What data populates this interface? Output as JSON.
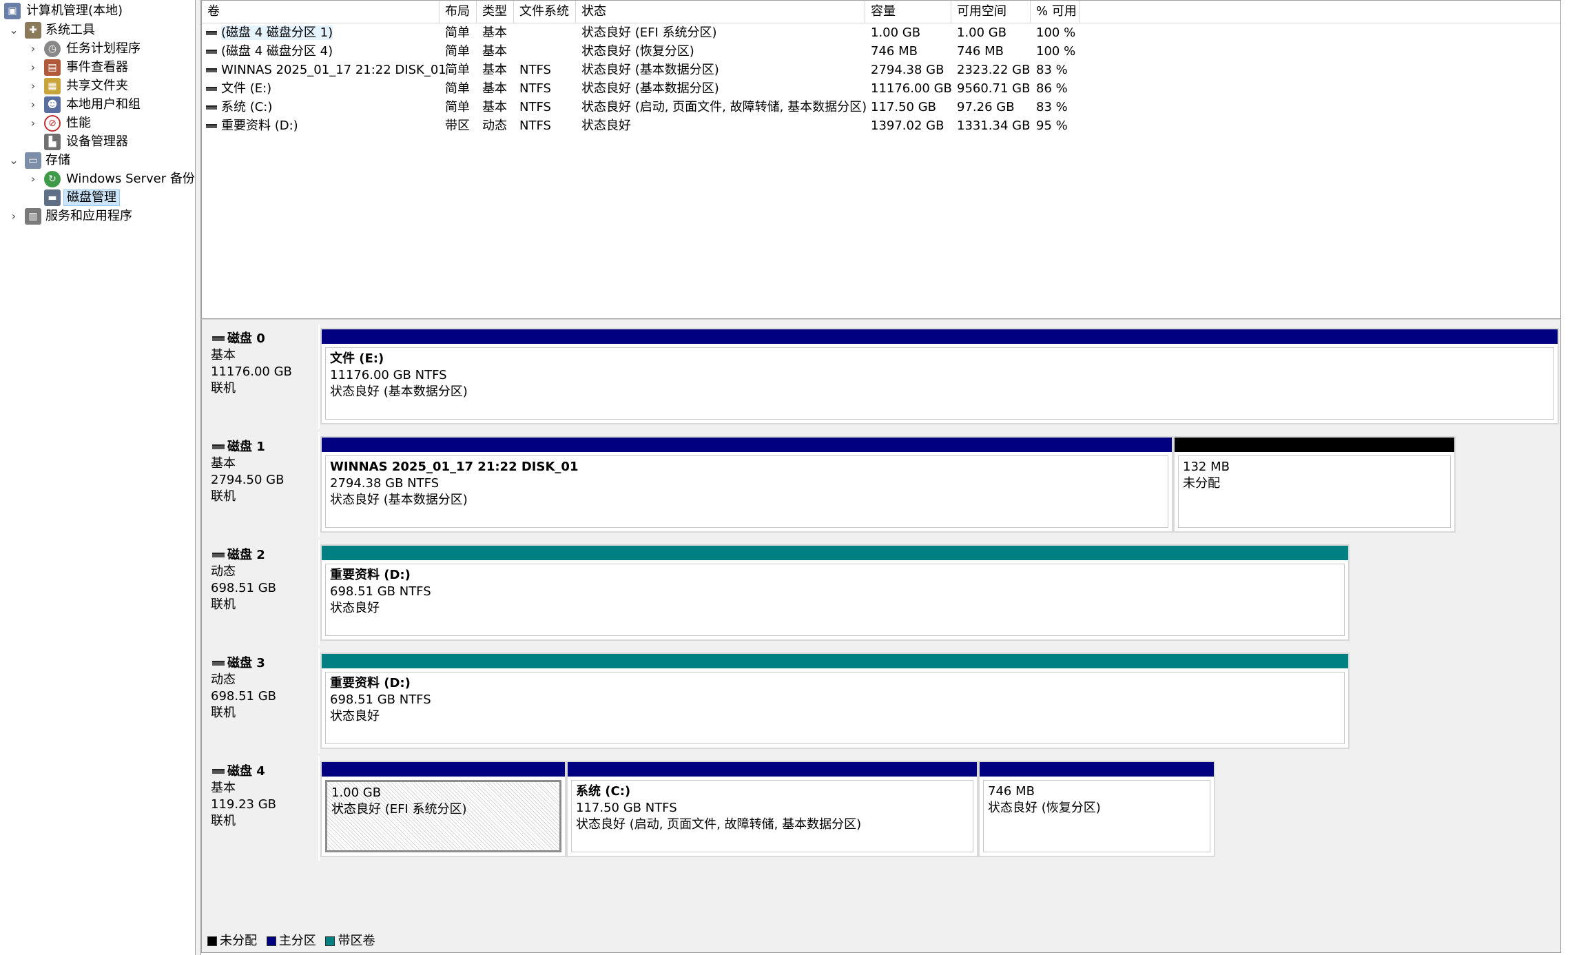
{
  "tree": {
    "root": "计算机管理(本地)",
    "system_tools": "系统工具",
    "task_scheduler": "任务计划程序",
    "event_viewer": "事件查看器",
    "shared_folders": "共享文件夹",
    "local_users": "本地用户和组",
    "performance": "性能",
    "device_manager": "设备管理器",
    "storage": "存储",
    "windows_server_backup": "Windows Server 备份",
    "disk_management": "磁盘管理",
    "services_apps": "服务和应用程序"
  },
  "columns": [
    "卷",
    "布局",
    "类型",
    "文件系统",
    "状态",
    "容量",
    "可用空间",
    "% 可用"
  ],
  "volumes": [
    {
      "name": "(磁盘 4 磁盘分区 1)",
      "layout": "简单",
      "type": "基本",
      "fs": "",
      "status": "状态良好 (EFI 系统分区)",
      "capacity": "1.00 GB",
      "free": "1.00 GB",
      "pct": "100 %"
    },
    {
      "name": "(磁盘 4 磁盘分区 4)",
      "layout": "简单",
      "type": "基本",
      "fs": "",
      "status": "状态良好 (恢复分区)",
      "capacity": "746 MB",
      "free": "746 MB",
      "pct": "100 %"
    },
    {
      "name": "WINNAS 2025_01_17 21:22 DISK_01",
      "layout": "简单",
      "type": "基本",
      "fs": "NTFS",
      "status": "状态良好 (基本数据分区)",
      "capacity": "2794.38 GB",
      "free": "2323.22 GB",
      "pct": "83 %"
    },
    {
      "name": "文件 (E:)",
      "layout": "简单",
      "type": "基本",
      "fs": "NTFS",
      "status": "状态良好 (基本数据分区)",
      "capacity": "11176.00 GB",
      "free": "9560.71 GB",
      "pct": "86 %"
    },
    {
      "name": "系统 (C:)",
      "layout": "简单",
      "type": "基本",
      "fs": "NTFS",
      "status": "状态良好 (启动, 页面文件, 故障转储, 基本数据分区)",
      "capacity": "117.50 GB",
      "free": "97.26 GB",
      "pct": "83 %"
    },
    {
      "name": "重要资料 (D:)",
      "layout": "带区",
      "type": "动态",
      "fs": "NTFS",
      "status": "状态良好",
      "capacity": "1397.02 GB",
      "free": "1331.34 GB",
      "pct": "95 %"
    }
  ],
  "disks": [
    {
      "name": "磁盘 0",
      "kind": "基本",
      "size": "11176.00 GB",
      "state": "联机",
      "partitions": [
        {
          "title": "文件  (E:)",
          "line1": "11176.00 GB NTFS",
          "line2": "状态良好 (基本数据分区)"
        }
      ]
    },
    {
      "name": "磁盘 1",
      "kind": "基本",
      "size": "2794.50 GB",
      "state": "联机",
      "partitions": [
        {
          "title": "WINNAS 2025_01_17 21:22 DISK_01",
          "line1": "2794.38 GB NTFS",
          "line2": "状态良好 (基本数据分区)"
        },
        {
          "title": "",
          "line1": "132 MB",
          "line2": "未分配"
        }
      ]
    },
    {
      "name": "磁盘 2",
      "kind": "动态",
      "size": "698.51 GB",
      "state": "联机",
      "partitions": [
        {
          "title": "重要资料  (D:)",
          "line1": "698.51 GB NTFS",
          "line2": "状态良好"
        }
      ]
    },
    {
      "name": "磁盘 3",
      "kind": "动态",
      "size": "698.51 GB",
      "state": "联机",
      "partitions": [
        {
          "title": "重要资料  (D:)",
          "line1": "698.51 GB NTFS",
          "line2": "状态良好"
        }
      ]
    },
    {
      "name": "磁盘 4",
      "kind": "基本",
      "size": "119.23 GB",
      "state": "联机",
      "partitions": [
        {
          "title": "",
          "line1": "1.00 GB",
          "line2": "状态良好 (EFI 系统分区)"
        },
        {
          "title": "系统  (C:)",
          "line1": "117.50 GB NTFS",
          "line2": "状态良好 (启动, 页面文件, 故障转储, 基本数据分区)"
        },
        {
          "title": "",
          "line1": "746 MB",
          "line2": "状态良好 (恢复分区)"
        }
      ]
    }
  ],
  "legend": {
    "unallocated": "未分配",
    "primary": "主分区",
    "striped": "带区卷"
  },
  "colors": {
    "primary": "#000080",
    "striped": "#008080",
    "unallocated": "#000000",
    "selection": "#cce4f7"
  }
}
